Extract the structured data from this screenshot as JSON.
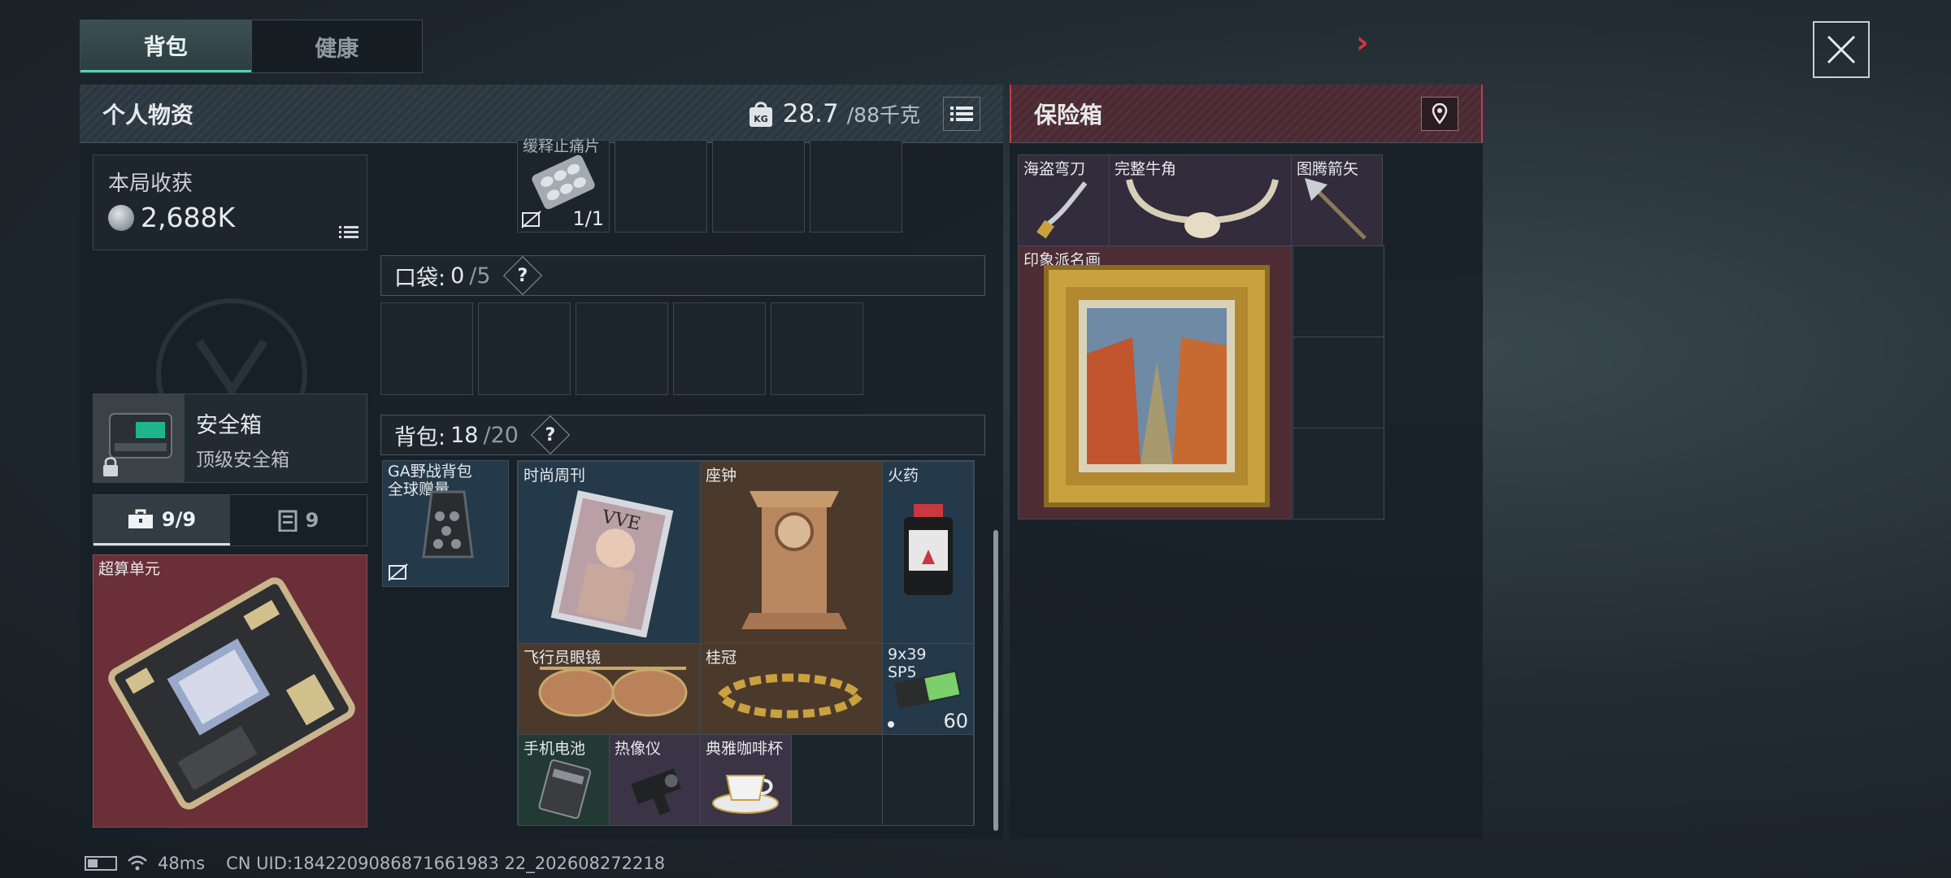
{
  "tabs": [
    {
      "label": "背包"
    },
    {
      "label": "健康"
    }
  ],
  "personal": {
    "title": "个人物资",
    "weight_current": "28.7",
    "weight_max": "/88千克",
    "weight_icon_text": "KG"
  },
  "haul": {
    "title": "本局收获",
    "value": "2,688K"
  },
  "safe_box": {
    "title": "安全箱",
    "subtitle": "顶级安全箱"
  },
  "sub_tabs": [
    {
      "label": "9/9"
    },
    {
      "label": "9"
    }
  ],
  "component": {
    "label": "超算单元"
  },
  "top_slot": {
    "label": "缓释止痛片",
    "qty": "1/1"
  },
  "pocket": {
    "label": "口袋:",
    "count": "0",
    "capacity": "/5",
    "help": "?"
  },
  "backpack": {
    "label": "背包:",
    "count": "18",
    "capacity": "/20",
    "help": "?",
    "bag_name": "GA野战背包\n全球赠量"
  },
  "bag_items": [
    {
      "label": "时尚周刊"
    },
    {
      "label": "座钟"
    },
    {
      "label": "火药"
    },
    {
      "label": "飞行员眼镜"
    },
    {
      "label": "桂冠"
    },
    {
      "label": "9x39\nSP5",
      "qty": "60"
    },
    {
      "label": "手机电池"
    },
    {
      "label": "热像仪"
    },
    {
      "label": "典雅咖啡杯"
    }
  ],
  "vault": {
    "title": "保险箱",
    "items": [
      {
        "label": "海盗弯刀"
      },
      {
        "label": "完整牛角"
      },
      {
        "label": "图腾箭矢"
      },
      {
        "label": "印象派名画"
      }
    ]
  },
  "status": {
    "ping": "48ms",
    "uid": "CN UID:1842209086871661983 22_202608272218"
  },
  "colors": {
    "accent": "#4fd2b0",
    "danger": "#d8323c",
    "vault_border": "#c0404a"
  }
}
